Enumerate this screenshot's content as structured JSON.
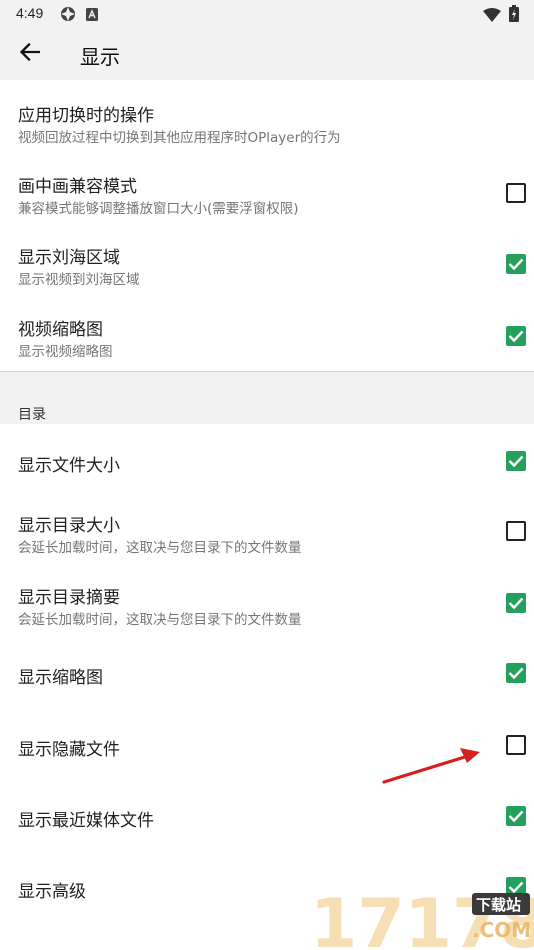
{
  "status_bar": {
    "time": "4:49"
  },
  "app_bar": {
    "title": "显示"
  },
  "rows_top": [
    {
      "title": "应用切换时的操作",
      "subtitle": "视频回放过程中切换到其他应用程序时OPlayer的行为"
    },
    {
      "title": "画中画兼容模式",
      "subtitle": "兼容模式能够调整播放窗口大小(需要浮窗权限)",
      "checked": false
    },
    {
      "title": "显示刘海区域",
      "subtitle": "显示视频到刘海区域",
      "checked": true
    },
    {
      "title": "视频缩略图",
      "subtitle": "显示视频缩略图",
      "checked": true
    }
  ],
  "section": {
    "label": "目录"
  },
  "rows_dir": [
    {
      "title": "显示文件大小",
      "checked": true
    },
    {
      "title": "显示目录大小",
      "subtitle": "会延长加载时间，这取决与您目录下的文件数量",
      "checked": false
    },
    {
      "title": "显示目录摘要",
      "subtitle": "会延长加载时间，这取决与您目录下的文件数量",
      "checked": true
    },
    {
      "title": "显示缩略图",
      "checked": true
    },
    {
      "title": "显示隐藏文件",
      "checked": false
    },
    {
      "title": "显示最近媒体文件",
      "checked": true
    },
    {
      "title": "显示高级",
      "checked": true
    }
  ],
  "watermark": {
    "text": "17178",
    "tag": "下载站",
    "domain": ".COM"
  },
  "colors": {
    "accent": "#25a05c",
    "arrow": "#d62020"
  }
}
